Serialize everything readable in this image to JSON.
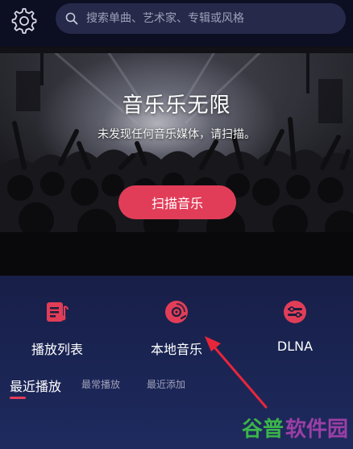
{
  "search": {
    "placeholder": "搜索单曲、艺术家、专辑或风格",
    "icon": "search-icon"
  },
  "settings": {
    "icon": "gear-icon"
  },
  "hero": {
    "title": "音乐乐无限",
    "subtitle": "未发现任何音乐媒体，请扫描。",
    "scan_button": "扫描音乐"
  },
  "actions": [
    {
      "label": "播放列表",
      "icon": "playlist-icon"
    },
    {
      "label": "本地音乐",
      "icon": "disc-icon"
    },
    {
      "label": "DLNA",
      "icon": "dlna-icon"
    }
  ],
  "tabs": [
    {
      "label": "最近播放",
      "active": true
    },
    {
      "label": "最常播放",
      "active": false
    },
    {
      "label": "最近添加",
      "active": false
    }
  ],
  "watermark": {
    "text": "谷普软件园"
  },
  "colors": {
    "accent": "#e23d58",
    "background_top": "#0d0f22",
    "background_bottom": "#1e2a5e",
    "search_bg": "#27294a",
    "tab_inactive": "#9ea0b8",
    "annotation_arrow": "#e8263a",
    "watermark_green": "#3ab54a",
    "watermark_purple": "#9b3fa6"
  }
}
